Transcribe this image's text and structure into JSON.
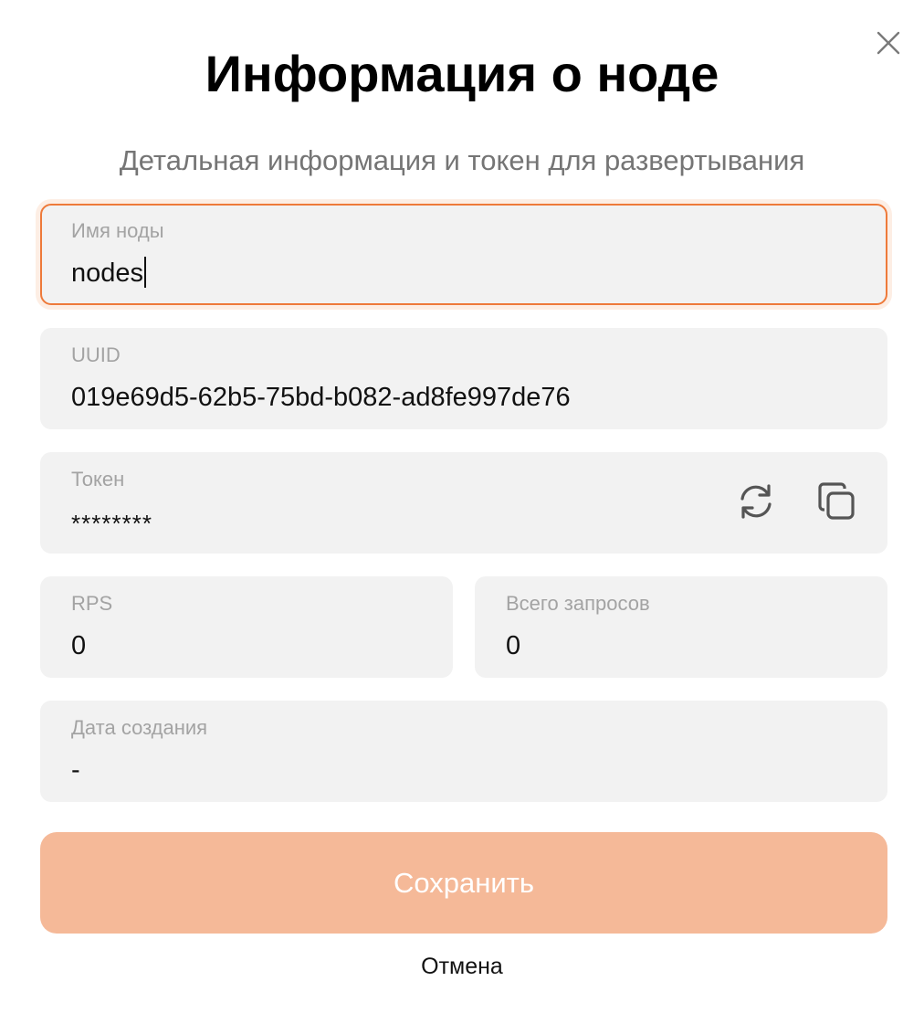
{
  "dialog": {
    "title": "Информация о ноде",
    "subtitle": "Детальная информация и токен для развертывания",
    "close_icon": "close-icon"
  },
  "fields": {
    "name": {
      "label": "Имя ноды",
      "value": "nodes"
    },
    "uuid": {
      "label": "UUID",
      "value": "019e69d5-62b5-75bd-b082-ad8fe997de76"
    },
    "token": {
      "label": "Токен",
      "value": "********",
      "refresh_icon": "refresh-icon",
      "copy_icon": "copy-icon"
    },
    "rps": {
      "label": "RPS",
      "value": "0"
    },
    "total_requests": {
      "label": "Всего запросов",
      "value": "0"
    },
    "created_at": {
      "label": "Дата создания",
      "value": "-"
    }
  },
  "actions": {
    "save_label": "Сохранить",
    "cancel_label": "Отмена"
  },
  "colors": {
    "accent": "#ee7a3a",
    "save_button_bg": "#f5b998",
    "field_bg": "#f2f2f2",
    "label": "#a3a3a3",
    "subtitle": "#757575"
  }
}
